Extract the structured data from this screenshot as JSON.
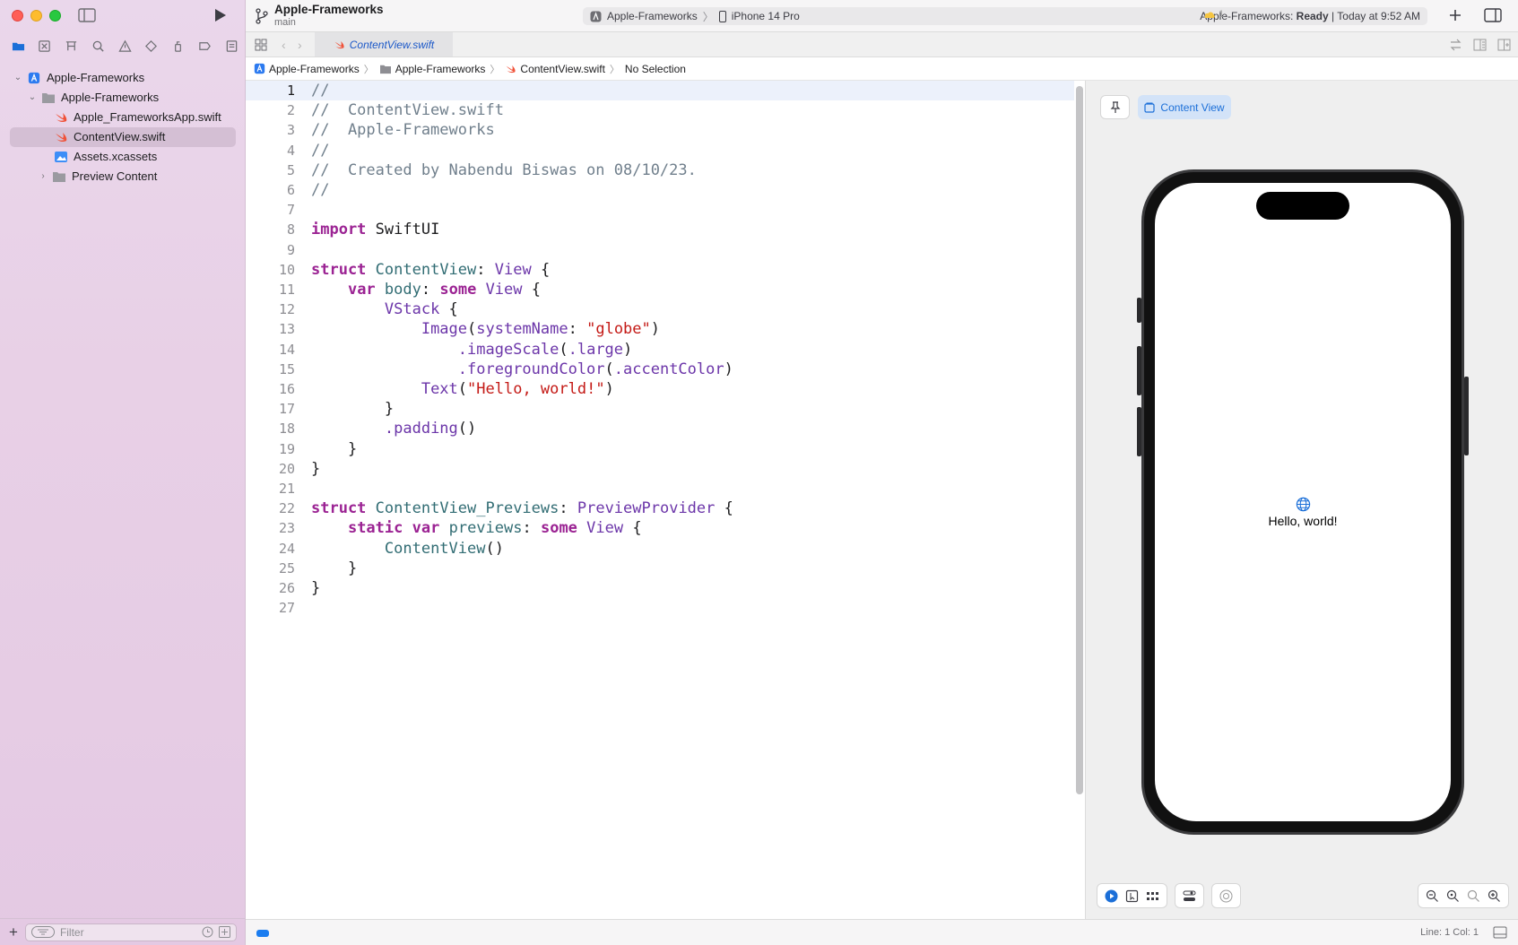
{
  "window": {
    "project_title": "Apple-Frameworks",
    "branch": "main"
  },
  "activity": {
    "scheme": "Apple-Frameworks",
    "device": "iPhone 14 Pro",
    "status_prefix": "Apple-Frameworks: ",
    "status_bold": "Ready",
    "status_suffix": " | Today at 9:52 AM",
    "warning_count": "1"
  },
  "tab": {
    "file": "ContentView.swift"
  },
  "breadcrumb": {
    "project": "Apple-Frameworks",
    "group": "Apple-Frameworks",
    "file": "ContentView.swift",
    "selection": "No Selection"
  },
  "navigator": {
    "items": [
      {
        "label": "Apple-Frameworks",
        "kind": "project"
      },
      {
        "label": "Apple-Frameworks",
        "kind": "folder"
      },
      {
        "label": "Apple_FrameworksApp.swift",
        "kind": "swift"
      },
      {
        "label": "ContentView.swift",
        "kind": "swift",
        "selected": true
      },
      {
        "label": "Assets.xcassets",
        "kind": "assets"
      },
      {
        "label": "Preview Content",
        "kind": "folder"
      }
    ],
    "filter_placeholder": "Filter"
  },
  "editor": {
    "current_line": 1,
    "lines": [
      "//",
      "//  ContentView.swift",
      "//  Apple-Frameworks",
      "//",
      "//  Created by Nabendu Biswas on 08/10/23.",
      "//",
      "",
      "import SwiftUI",
      "",
      "struct ContentView: View {",
      "    var body: some View {",
      "        VStack {",
      "            Image(systemName: \"globe\")",
      "                .imageScale(.large)",
      "                .foregroundColor(.accentColor)",
      "            Text(\"Hello, world!\")",
      "        }",
      "        .padding()",
      "    }",
      "}",
      "",
      "struct ContentView_Previews: PreviewProvider {",
      "    static var previews: some View {",
      "        ContentView()",
      "    }",
      "}",
      ""
    ]
  },
  "canvas": {
    "preview_label": "Content View",
    "preview_text": "Hello, world!"
  },
  "status": {
    "line_col": "Line: 1  Col: 1"
  },
  "colors": {
    "accent": "#1b6fd8",
    "sidebar_bg": "#e8d0e6",
    "keyword": "#9b2393",
    "string": "#c41a16",
    "comment": "#707f8c"
  }
}
